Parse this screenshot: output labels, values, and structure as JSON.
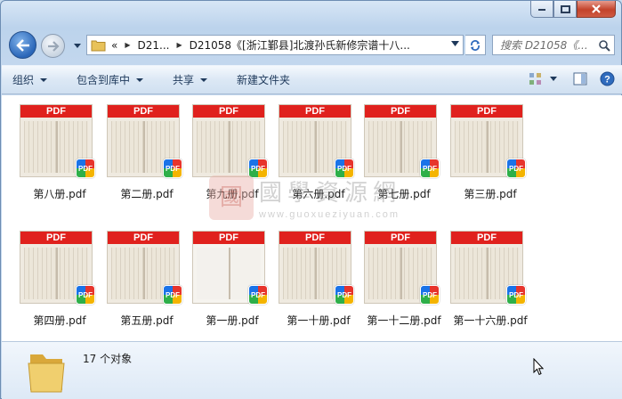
{
  "window": {
    "caption": {
      "minimize": "minimize",
      "maximize": "maximize",
      "close": "close"
    }
  },
  "nav": {
    "address": {
      "overflow": "«",
      "segments": [
        "D21...",
        "D21058《[浙江鄞县]北渡孙氏新修宗谱十八..."
      ]
    },
    "search": {
      "placeholder": "搜索 D21058《..."
    }
  },
  "toolbar": {
    "items": [
      {
        "label": "组织",
        "has_menu": true
      },
      {
        "label": "包含到库中",
        "has_menu": true
      },
      {
        "label": "共享",
        "has_menu": true
      },
      {
        "label": "新建文件夹",
        "has_menu": false
      }
    ]
  },
  "files": [
    {
      "name": "第八册.pdf",
      "thumb_label": "PDF",
      "badge": "PDF"
    },
    {
      "name": "第二册.pdf",
      "thumb_label": "PDF",
      "badge": "PDF"
    },
    {
      "name": "第九册.pdf",
      "thumb_label": "PDF",
      "badge": "PDF"
    },
    {
      "name": "第六册.pdf",
      "thumb_label": "PDF",
      "badge": "PDF"
    },
    {
      "name": "第七册.pdf",
      "thumb_label": "PDF",
      "badge": "PDF"
    },
    {
      "name": "第三册.pdf",
      "thumb_label": "PDF",
      "badge": "PDF"
    },
    {
      "name": "第四册.pdf",
      "thumb_label": "PDF",
      "badge": "PDF"
    },
    {
      "name": "第五册.pdf",
      "thumb_label": "PDF",
      "badge": "PDF"
    },
    {
      "name": "第一册.pdf",
      "thumb_label": "PDF",
      "badge": "PDF"
    },
    {
      "name": "第一十册.pdf",
      "thumb_label": "PDF",
      "badge": "PDF"
    },
    {
      "name": "第一十二册.pdf",
      "thumb_label": "PDF",
      "badge": "PDF"
    },
    {
      "name": "第一十六册.pdf",
      "thumb_label": "PDF",
      "badge": "PDF"
    }
  ],
  "watermark": {
    "seal": "國",
    "title": "國學資源網",
    "url": "www.guoxueziyuan.com"
  },
  "details": {
    "count": "17 个对象"
  },
  "colors": {
    "pdf_band": "#e0211d",
    "toolbar_text": "#1e395b",
    "window_frame": "#c4d8ee"
  }
}
